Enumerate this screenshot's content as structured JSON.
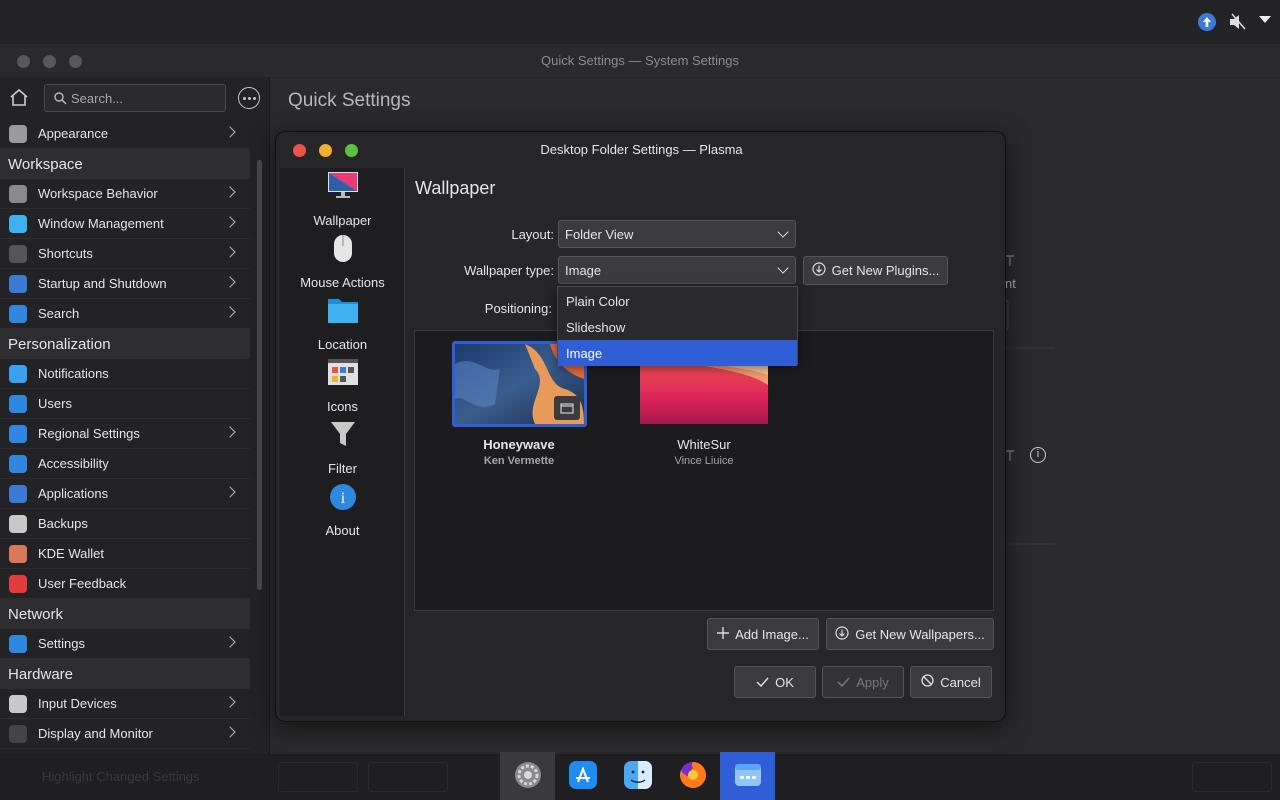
{
  "topbar": {
    "icons": [
      "update-arrow-icon",
      "speaker-muted-icon",
      "chevron-down-icon"
    ]
  },
  "window": {
    "title": "Quick Settings — System Settings"
  },
  "sidebar": {
    "search_placeholder": "Search...",
    "items": [
      {
        "label": "Appearance",
        "icon": "appearance-icon",
        "chevron": true
      },
      {
        "section": "Workspace"
      },
      {
        "label": "Workspace Behavior",
        "icon": "workspace-behavior-icon",
        "chevron": true
      },
      {
        "label": "Window Management",
        "icon": "window-management-icon",
        "chevron": true
      },
      {
        "label": "Shortcuts",
        "icon": "command-key-icon",
        "chevron": true
      },
      {
        "label": "Startup and Shutdown",
        "icon": "startup-icon",
        "chevron": true
      },
      {
        "label": "Search",
        "icon": "search-icon",
        "chevron": true
      },
      {
        "section": "Personalization"
      },
      {
        "label": "Notifications",
        "icon": "notifications-icon",
        "chevron": false
      },
      {
        "label": "Users",
        "icon": "user-icon",
        "chevron": false
      },
      {
        "label": "Regional Settings",
        "icon": "globe-icon",
        "chevron": true
      },
      {
        "label": "Accessibility",
        "icon": "accessibility-icon",
        "chevron": false
      },
      {
        "label": "Applications",
        "icon": "applications-icon",
        "chevron": true
      },
      {
        "label": "Backups",
        "icon": "backups-icon",
        "chevron": false
      },
      {
        "label": "KDE Wallet",
        "icon": "wallet-icon",
        "chevron": false
      },
      {
        "label": "User Feedback",
        "icon": "feedback-icon",
        "chevron": false
      },
      {
        "section": "Network"
      },
      {
        "label": "Settings",
        "icon": "network-settings-icon",
        "chevron": true
      },
      {
        "section": "Hardware"
      },
      {
        "label": "Input Devices",
        "icon": "input-devices-icon",
        "chevron": true
      },
      {
        "label": "Display and Monitor",
        "icon": "display-icon",
        "chevron": true
      }
    ]
  },
  "main": {
    "title": "Quick Settings"
  },
  "dialog": {
    "title": "Desktop Folder Settings — Plasma",
    "categories": [
      "Wallpaper",
      "Mouse Actions",
      "Location",
      "Icons",
      "Filter",
      "About"
    ],
    "heading": "Wallpaper",
    "layout_label": "Layout:",
    "layout_value": "Folder View",
    "type_label": "Wallpaper type:",
    "type_value": "Image",
    "positioning_label": "Positioning:",
    "get_plugins": "Get New Plugins...",
    "type_options": [
      "Plain Color",
      "Slideshow",
      "Image"
    ],
    "selected_option": "Image",
    "wallpapers": [
      {
        "name": "Honeywave",
        "author": "Ken Vermette",
        "selected": true
      },
      {
        "name": "WhiteSur",
        "author": "Vince Liuice",
        "selected": false
      }
    ],
    "add_image": "Add Image...",
    "get_wallpapers": "Get New Wallpapers...",
    "ok": "OK",
    "apply": "Apply",
    "cancel": "Cancel"
  },
  "bottom": {
    "highlight": "Highlight Changed Settings"
  },
  "dock": {
    "apps": [
      "system-settings-icon",
      "app-store-icon",
      "finder-icon",
      "firefox-icon",
      "dolphin-icon"
    ]
  },
  "colors": {
    "accent": "#2f5ed6",
    "close": "#e9534b",
    "minimize": "#f0b030",
    "maximize": "#5ac23f"
  }
}
